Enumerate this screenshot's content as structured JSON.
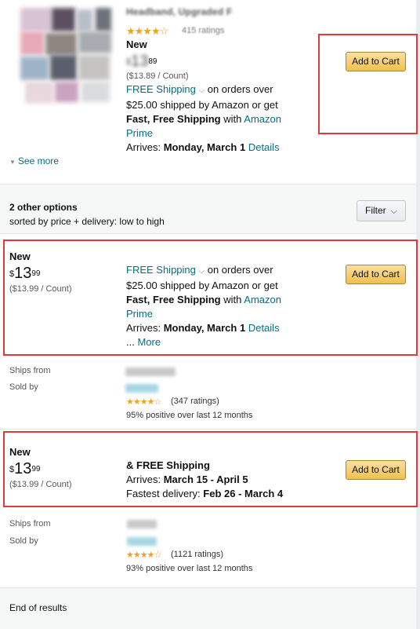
{
  "top_listing": {
    "title": "Headband, Upgraded F",
    "stars": "★★★★☆",
    "ratings": "415 ratings",
    "condition": "New",
    "price_symbol": "$",
    "price_whole": "13",
    "price_cents": "89",
    "unit_price": "($13.89 / Count)",
    "free_shipping": "FREE Shipping",
    "shipping_tail": "on orders over",
    "shipping_line2": "$25.00 shipped by Amazon or get",
    "fast_free": "Fast, Free Shipping",
    "with": "with",
    "amazon": "Amazon",
    "prime": "Prime",
    "arrives_label": "Arrives:",
    "arrives_date": "Monday, March 1",
    "details": "Details",
    "add_to_cart": "Add to Cart",
    "see_more": "See more"
  },
  "options_header": {
    "count": "2 other options",
    "sort": "sorted by price + delivery: low to high",
    "filter": "Filter"
  },
  "offers": [
    {
      "condition": "New",
      "price_symbol": "$",
      "price_whole": "13",
      "price_cents": "99",
      "unit_price": "($13.99 / Count)",
      "free_shipping": "FREE Shipping",
      "shipping_tail": "on orders over",
      "shipping_line2": "$25.00 shipped by Amazon or get",
      "fast_free": "Fast, Free Shipping",
      "with": "with",
      "amazon": "Amazon",
      "prime": "Prime",
      "arrives_label": "Arrives:",
      "arrives_date": "Monday, March 1",
      "details": "Details",
      "more_prefix": "...",
      "more": "More",
      "add_to_cart": "Add to Cart",
      "ships_from_label": "Ships from",
      "sold_by_label": "Sold by",
      "seller_stars": "★★★★☆",
      "seller_ratings": "(347 ratings)",
      "seller_positive": "95% positive over last 12 months"
    },
    {
      "condition": "New",
      "price_symbol": "$",
      "price_whole": "13",
      "price_cents": "99",
      "unit_price": "($13.99 / Count)",
      "free_shipping_line": "& FREE Shipping",
      "arrives_label": "Arrives:",
      "arrives_date": "March 15 - April 5",
      "fastest_label": "Fastest delivery:",
      "fastest_date": "Feb 26 - March 4",
      "add_to_cart": "Add to Cart",
      "ships_from_label": "Ships from",
      "sold_by_label": "Sold by",
      "seller_stars": "★★★★☆",
      "seller_ratings": "(1121 ratings)",
      "seller_positive": "93% positive over last 12 months"
    }
  ],
  "end_text": "End of results",
  "colors": {
    "highlight": "#e03a3a",
    "link": "#007185",
    "star": "#f1a126",
    "button": "#f0c14b"
  }
}
